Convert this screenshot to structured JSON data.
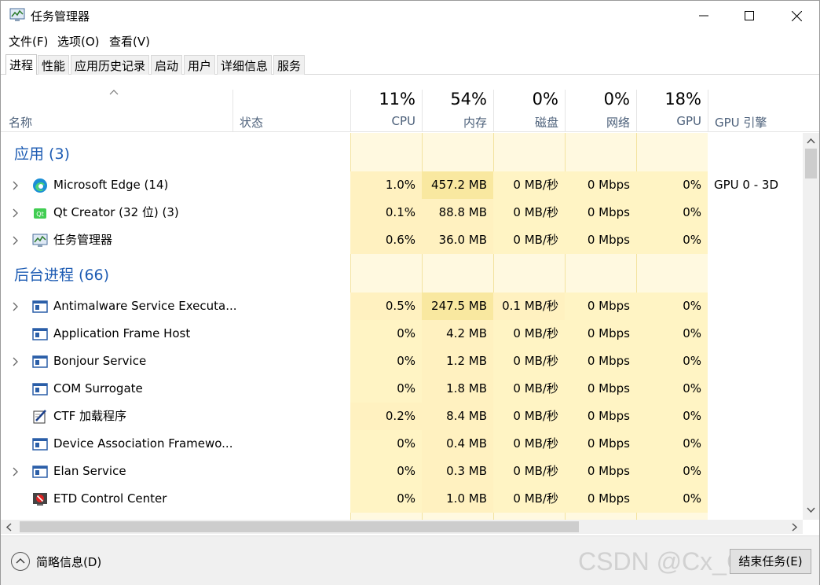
{
  "window": {
    "title": "任务管理器",
    "min_icon": "minimize-icon",
    "max_icon": "maximize-icon",
    "close_icon": "close-icon"
  },
  "menu": [
    "文件(F)",
    "选项(O)",
    "查看(V)"
  ],
  "tabs": [
    "进程",
    "性能",
    "应用历史记录",
    "启动",
    "用户",
    "详细信息",
    "服务"
  ],
  "header": {
    "name": "名称",
    "status": "状态",
    "cpu": {
      "pct": "11%",
      "label": "CPU"
    },
    "mem": {
      "pct": "54%",
      "label": "内存"
    },
    "disk": {
      "pct": "0%",
      "label": "磁盘"
    },
    "net": {
      "pct": "0%",
      "label": "网络"
    },
    "gpu": {
      "pct": "18%",
      "label": "GPU"
    },
    "gpu_engine": "GPU 引擎"
  },
  "groups": {
    "apps": "应用 (3)",
    "background": "后台进程 (66)"
  },
  "apps": [
    {
      "name": "Microsoft Edge (14)",
      "icon": "edge-icon",
      "cpu": "1.0%",
      "mem": "457.2 MB",
      "disk": "0 MB/秒",
      "net": "0 Mbps",
      "gpu": "0%",
      "engine": "GPU 0 - 3D"
    },
    {
      "name": "Qt Creator (32 位) (3)",
      "icon": "qt-icon",
      "cpu": "0.1%",
      "mem": "88.8 MB",
      "disk": "0 MB/秒",
      "net": "0 Mbps",
      "gpu": "0%",
      "engine": ""
    },
    {
      "name": "任务管理器",
      "icon": "task-manager-icon",
      "cpu": "0.6%",
      "mem": "36.0 MB",
      "disk": "0 MB/秒",
      "net": "0 Mbps",
      "gpu": "0%",
      "engine": ""
    }
  ],
  "background": [
    {
      "name": "Antimalware Service Executa...",
      "icon": "service-window-icon",
      "cpu": "0.5%",
      "mem": "247.5 MB",
      "disk": "0.1 MB/秒",
      "net": "0 Mbps",
      "gpu": "0%"
    },
    {
      "name": "Application Frame Host",
      "icon": "service-window-icon",
      "cpu": "0%",
      "mem": "4.2 MB",
      "disk": "0 MB/秒",
      "net": "0 Mbps",
      "gpu": "0%"
    },
    {
      "name": "Bonjour Service",
      "icon": "service-window-icon",
      "cpu": "0%",
      "mem": "1.2 MB",
      "disk": "0 MB/秒",
      "net": "0 Mbps",
      "gpu": "0%"
    },
    {
      "name": "COM Surrogate",
      "icon": "service-window-icon",
      "cpu": "0%",
      "mem": "1.8 MB",
      "disk": "0 MB/秒",
      "net": "0 Mbps",
      "gpu": "0%"
    },
    {
      "name": "CTF 加载程序",
      "icon": "ctf-pen-icon",
      "cpu": "0.2%",
      "mem": "8.4 MB",
      "disk": "0 MB/秒",
      "net": "0 Mbps",
      "gpu": "0%"
    },
    {
      "name": "Device Association Framewo...",
      "icon": "service-window-icon",
      "cpu": "0%",
      "mem": "0.4 MB",
      "disk": "0 MB/秒",
      "net": "0 Mbps",
      "gpu": "0%"
    },
    {
      "name": "Elan Service",
      "icon": "service-window-icon",
      "cpu": "0%",
      "mem": "0.3 MB",
      "disk": "0 MB/秒",
      "net": "0 Mbps",
      "gpu": "0%"
    },
    {
      "name": "ETD Control Center",
      "icon": "etd-icon",
      "cpu": "0%",
      "mem": "1.0 MB",
      "disk": "0 MB/秒",
      "net": "0 Mbps",
      "gpu": "0%"
    }
  ],
  "footer": {
    "fewer_details": "简略信息(D)",
    "end_task": "结束任务(E)",
    "watermark": "CSDN @Cx_Cla"
  },
  "colors": {
    "heat_light": "#fff4c4",
    "heat_dark": "#f9eca8",
    "group_blue": "#1e5cb3",
    "header_text": "#4c607a"
  }
}
